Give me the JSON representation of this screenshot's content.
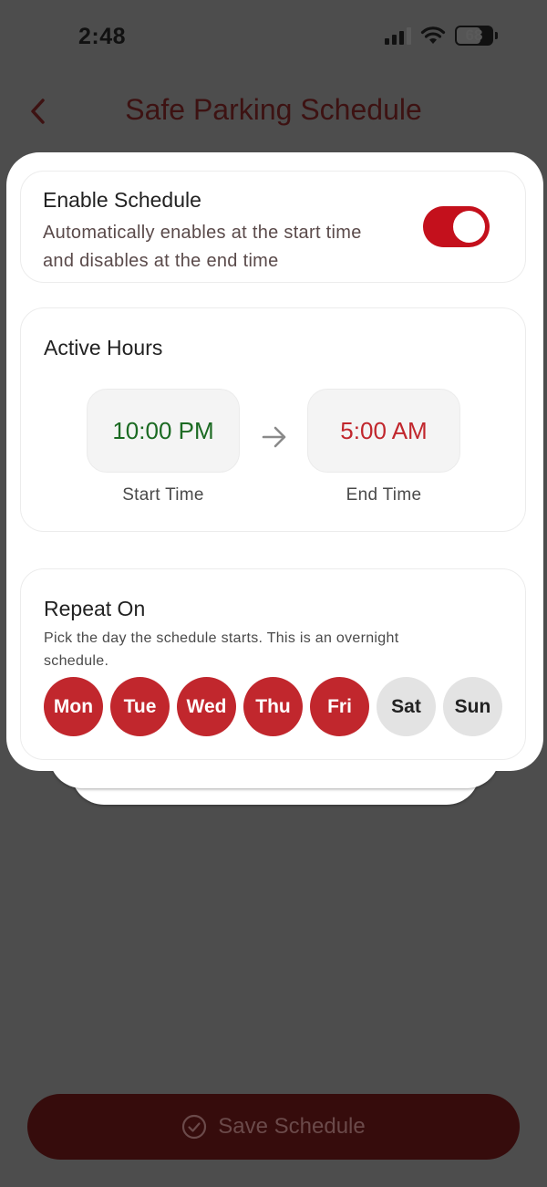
{
  "status_bar": {
    "time": "2:48",
    "battery": "68"
  },
  "nav": {
    "title": "Safe Parking Schedule"
  },
  "enable_schedule": {
    "title": "Enable Schedule",
    "description": "Automatically enables at the start time and disables at the end time",
    "enabled": true
  },
  "active_hours": {
    "title": "Active Hours",
    "start_time": "10:00 PM",
    "start_label": "Start Time",
    "end_time": "5:00 AM",
    "end_label": "End Time"
  },
  "repeat_on": {
    "title": "Repeat On",
    "description": "Pick the day the schedule starts. This is an overnight schedule.",
    "days": [
      {
        "label": "Mon",
        "selected": true
      },
      {
        "label": "Tue",
        "selected": true
      },
      {
        "label": "Wed",
        "selected": true
      },
      {
        "label": "Thu",
        "selected": true
      },
      {
        "label": "Fri",
        "selected": true
      },
      {
        "label": "Sat",
        "selected": false
      },
      {
        "label": "Sun",
        "selected": false
      }
    ]
  },
  "footer": {
    "save_label": "Save Schedule"
  },
  "colors": {
    "accent": "#c1272d",
    "toggle_on": "#c4101c",
    "start_time": "#1b6a22",
    "end_time": "#c1272d",
    "overlay": "#4d4d4d"
  },
  "icons": {
    "back": "chevron-left-icon",
    "arrow": "arrow-right-icon",
    "save": "check-circle-icon"
  }
}
